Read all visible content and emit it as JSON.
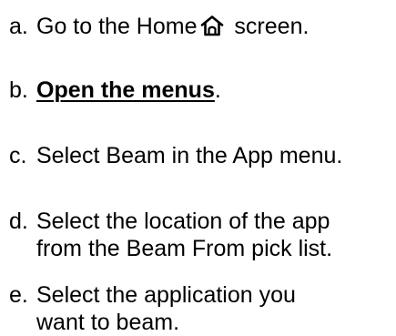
{
  "steps": [
    {
      "marker": "a.",
      "before": "Go to the Home",
      "icon": "home-icon",
      "after": "screen."
    },
    {
      "marker": "b.",
      "link": "Open the menus",
      "after": "."
    },
    {
      "marker": "c.",
      "text": "Select Beam in the App menu."
    },
    {
      "marker": "d.",
      "line1": "Select the location of the app",
      "line2": "from the Beam From pick list."
    },
    {
      "marker": "e.",
      "line1": "Select the application you",
      "line2": "want to beam."
    }
  ]
}
